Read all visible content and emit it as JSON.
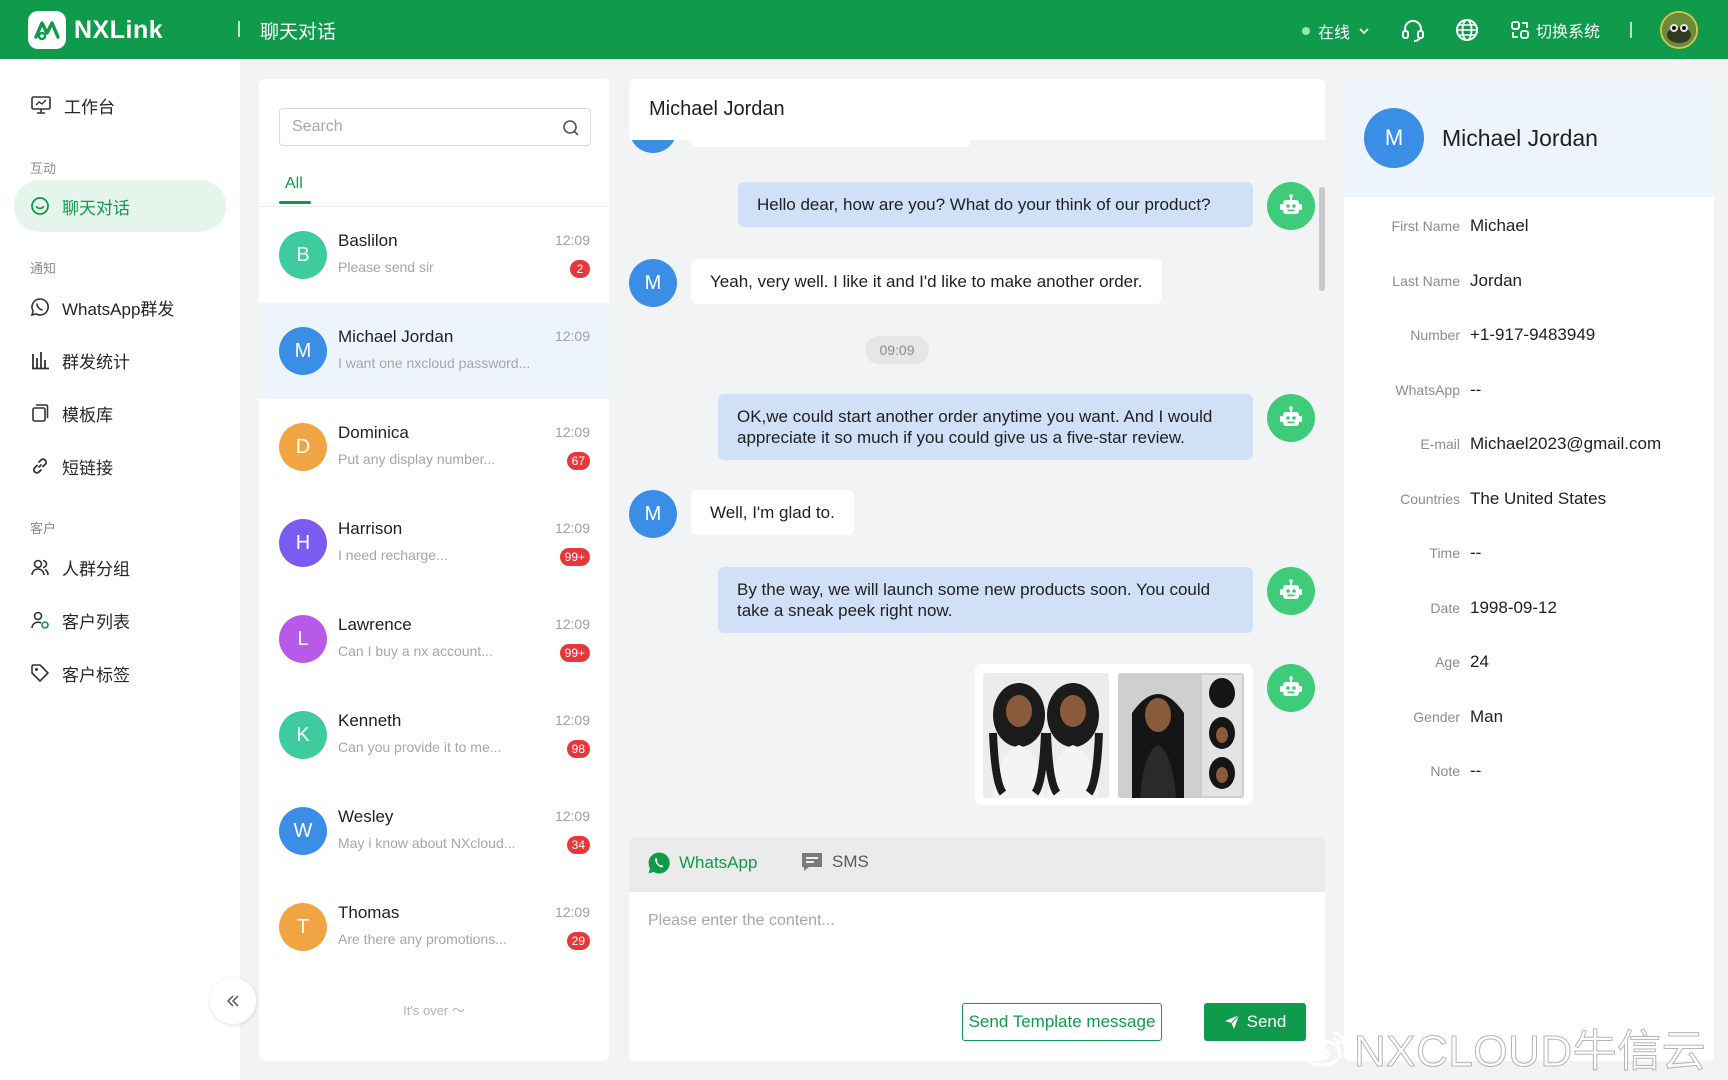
{
  "brand": {
    "name": "NXLink",
    "green": "#109a4c",
    "blue_avatar": "#3a8ee6",
    "bot_green": "#3ecb7a",
    "badge_red": "#e5383b"
  },
  "topbar": {
    "page_title": "聊天对话",
    "status_label": "在线",
    "switch_system_label": "切换系统",
    "icons": [
      "headset-icon",
      "globe-icon",
      "switch-system-icon"
    ]
  },
  "sidebar": {
    "workbench": "工作台",
    "group_interaction": "互动",
    "chat": "聊天对话",
    "group_notify": "通知",
    "whatsapp_mass": "WhatsApp群发",
    "mass_stats": "群发统计",
    "templates": "模板库",
    "short_links": "短链接",
    "group_customers": "客户",
    "segments": "人群分组",
    "customer_list": "客户列表",
    "customer_tags": "客户标签"
  },
  "conversations": {
    "search_placeholder": "Search",
    "tab_all": "All",
    "items": [
      {
        "initial": "B",
        "name": "Baslilon",
        "time": "12:09",
        "preview": "Please send sir",
        "badge": "2",
        "color": "#3ecb9e"
      },
      {
        "initial": "M",
        "name": "Michael Jordan",
        "time": "12:09",
        "preview": "I want one nxcloud password...",
        "badge": "",
        "color": "#3a8ee6"
      },
      {
        "initial": "D",
        "name": "Dominica",
        "time": "12:09",
        "preview": "Put any display number...",
        "badge": "67",
        "color": "#f0a442"
      },
      {
        "initial": "H",
        "name": "Harrison",
        "time": "12:09",
        "preview": "I need recharge...",
        "badge": "99+",
        "color": "#7b5cf0"
      },
      {
        "initial": "L",
        "name": "Lawrence",
        "time": "12:09",
        "preview": "Can I buy a nx account...",
        "badge": "99+",
        "color": "#b85ae8"
      },
      {
        "initial": "K",
        "name": "Kenneth",
        "time": "12:09",
        "preview": "Can you provide it to me...",
        "badge": "98",
        "color": "#3ecb9e"
      },
      {
        "initial": "W",
        "name": "Wesley",
        "time": "12:09",
        "preview": "May i know about NXcloud...",
        "badge": "34",
        "color": "#3a8ee6"
      },
      {
        "initial": "T",
        "name": "Thomas",
        "time": "12:09",
        "preview": "Are there any promotions...",
        "badge": "29",
        "color": "#f0a442"
      }
    ],
    "end_text": "It's over ～"
  },
  "chat": {
    "contact_name": "Michael Jordan",
    "user_initial": "M",
    "messages": [
      {
        "from": "agent",
        "text": "Hello dear, how are you? What do your think of our product?"
      },
      {
        "from": "user",
        "text": "Yeah, very well. I like it and I'd like to make another order."
      },
      {
        "from": "agent",
        "text": "OK,we could start another order anytime you want. And I would appreciate it so much if you could give us a five-star review."
      },
      {
        "from": "user",
        "text": "Well, I'm glad to."
      },
      {
        "from": "agent",
        "text": "By the way, we will launch some new products soon. You could take a sneak peek right now."
      }
    ],
    "timestamp": "09:09",
    "composer": {
      "tab_whatsapp": "WhatsApp",
      "tab_sms": "SMS",
      "placeholder": "Please enter the content...",
      "template_button": "Send Template message",
      "send_button": "Send"
    }
  },
  "profile": {
    "initial": "M",
    "name": "Michael Jordan",
    "fields": [
      {
        "label": "First Name",
        "value": "Michael"
      },
      {
        "label": "Last Name",
        "value": "Jordan"
      },
      {
        "label": "Number",
        "value": "+1-917-9483949"
      },
      {
        "label": "WhatsApp",
        "value": "--"
      },
      {
        "label": "E-mail",
        "value": "Michael2023@gmail.com"
      },
      {
        "label": "Countries",
        "value": "The United States"
      },
      {
        "label": "Time",
        "value": "--"
      },
      {
        "label": "Date",
        "value": "1998-09-12"
      },
      {
        "label": "Age",
        "value": "24"
      },
      {
        "label": "Gender",
        "value": "Man"
      },
      {
        "label": "Note",
        "value": "--"
      }
    ]
  },
  "watermark": "NXCLOUD牛信云"
}
